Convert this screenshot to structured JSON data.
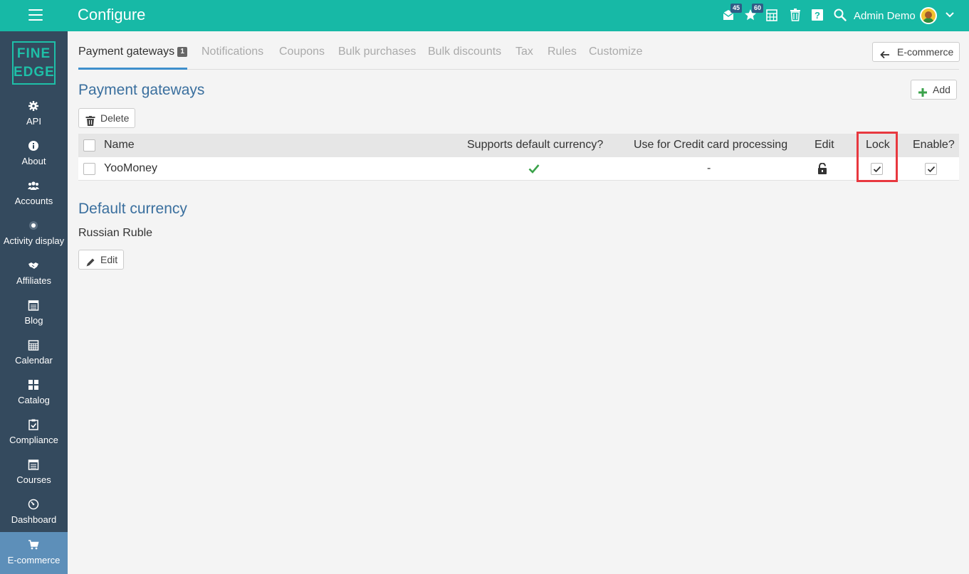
{
  "header": {
    "title": "Configure",
    "messages_count": "45",
    "notifications_count": "60",
    "user_name": "Admin Demo"
  },
  "logo": {
    "line1": "FINE",
    "line2": "EDGE"
  },
  "sidebar": {
    "items": [
      {
        "label": "API",
        "icon": "gear-icon"
      },
      {
        "label": "About",
        "icon": "info-icon"
      },
      {
        "label": "Accounts",
        "icon": "users-icon"
      },
      {
        "label": "Activity display",
        "icon": "activity-icon"
      },
      {
        "label": "Affiliates",
        "icon": "handshake-icon"
      },
      {
        "label": "Blog",
        "icon": "blog-icon"
      },
      {
        "label": "Calendar",
        "icon": "calendar-icon"
      },
      {
        "label": "Catalog",
        "icon": "grid-icon"
      },
      {
        "label": "Compliance",
        "icon": "clipboard-check-icon"
      },
      {
        "label": "Courses",
        "icon": "courses-icon"
      },
      {
        "label": "Dashboard",
        "icon": "dashboard-icon"
      },
      {
        "label": "E-commerce",
        "icon": "cart-icon",
        "active": true
      }
    ]
  },
  "tabs": [
    {
      "label": "Payment gateways",
      "count": "1",
      "active": true
    },
    {
      "label": "Notifications"
    },
    {
      "label": "Coupons"
    },
    {
      "label": "Bulk purchases"
    },
    {
      "label": "Bulk discounts"
    },
    {
      "label": "Tax"
    },
    {
      "label": "Rules"
    },
    {
      "label": "Customize"
    }
  ],
  "back_button": "E-commerce",
  "payment_section": {
    "title": "Payment gateways",
    "add_label": "Add",
    "delete_label": "Delete",
    "columns": {
      "name": "Name",
      "supports_default": "Supports default currency?",
      "credit_card": "Use for Credit card processing",
      "edit": "Edit",
      "lock": "Lock",
      "enable": "Enable?"
    },
    "rows": [
      {
        "name": "YooMoney",
        "supports_default": "check",
        "credit_card": "-",
        "edit": "unlock-icon",
        "lock": true,
        "enable": true
      }
    ]
  },
  "currency_section": {
    "title": "Default currency",
    "value": "Russian Ruble",
    "edit_label": "Edit"
  },
  "colors": {
    "topbar": "#17b9a6",
    "sidebar": "#344a5e",
    "sidebar_active": "#5d8fb9",
    "section_title": "#3a6f9e",
    "highlight": "#e8383f",
    "check_green": "#3aa24a"
  }
}
